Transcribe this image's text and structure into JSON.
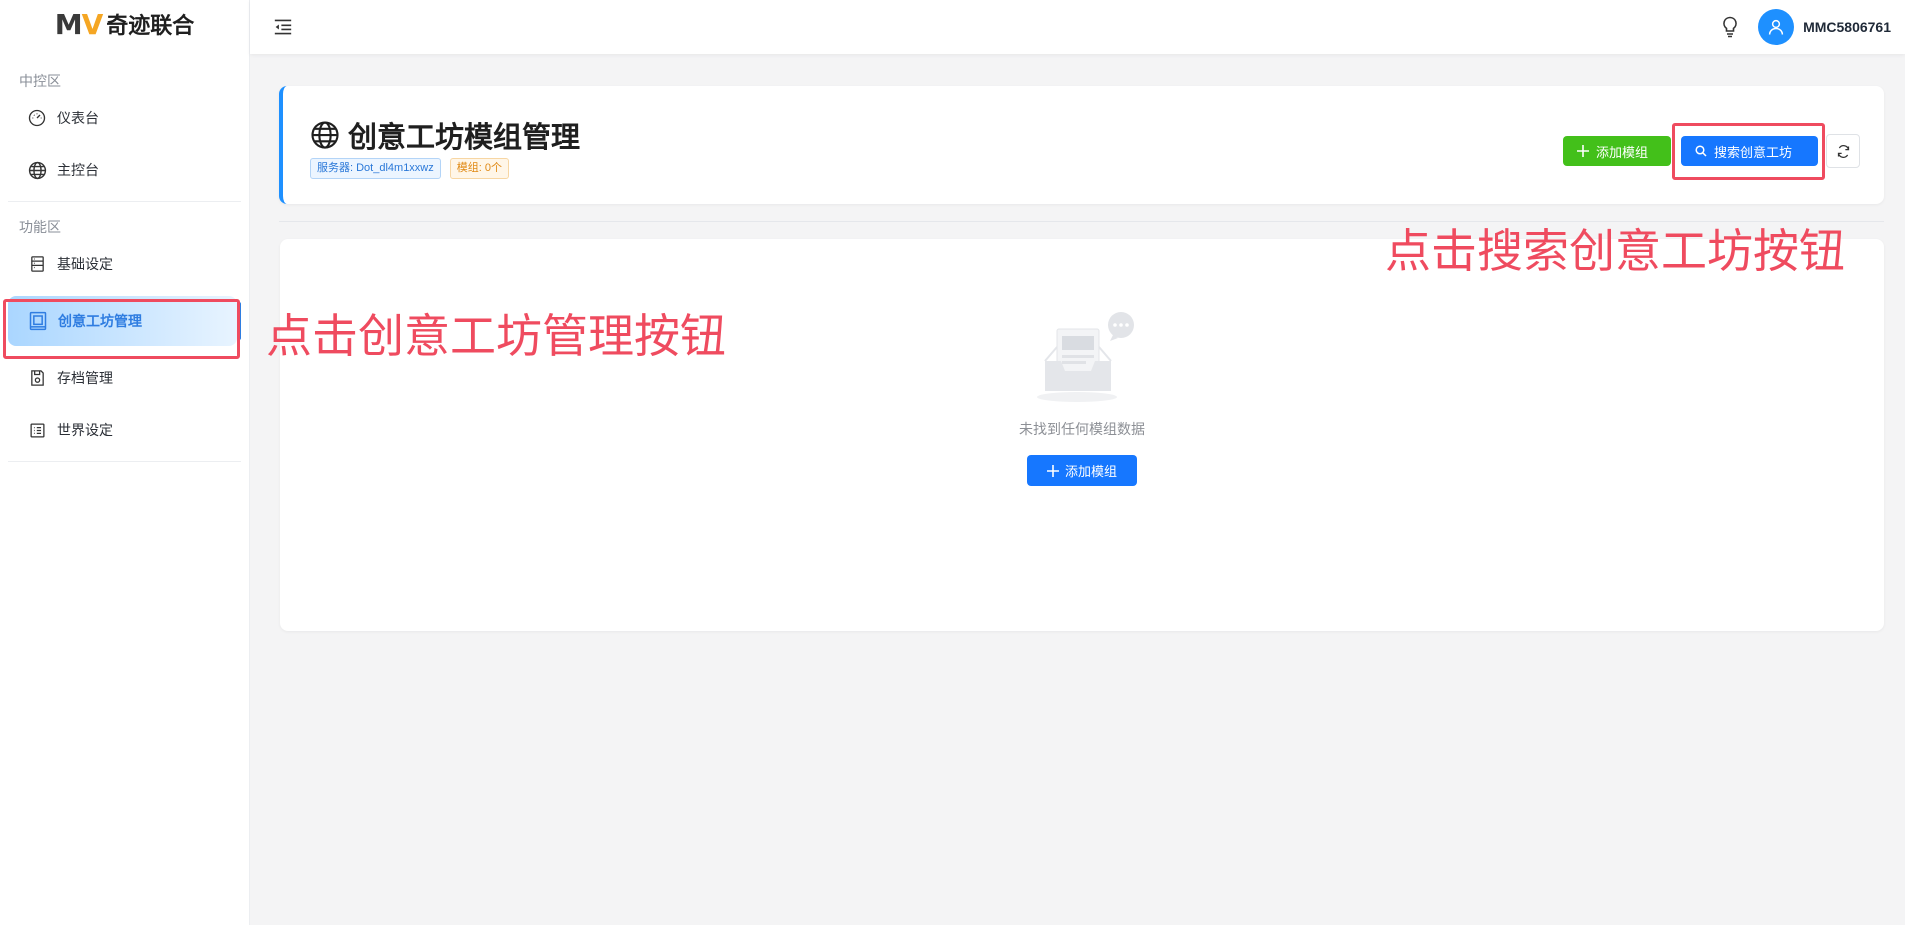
{
  "app": {
    "logo_mark_m": "M",
    "logo_mark_v": "V",
    "logo_text": "奇迹联合"
  },
  "sidebar": {
    "section1_title": "中控区",
    "section1_items": [
      {
        "label": "仪表台",
        "icon": "dashboard-gauge-icon"
      },
      {
        "label": "主控台",
        "icon": "globe-icon"
      }
    ],
    "section2_title": "功能区",
    "section2_items": [
      {
        "label": "基础设定",
        "icon": "server-list-icon"
      },
      {
        "label": "创意工坊管理",
        "icon": "workshop-frame-icon",
        "active": true
      },
      {
        "label": "存档管理",
        "icon": "save-disk-icon"
      },
      {
        "label": "世界设定",
        "icon": "list-icon"
      }
    ]
  },
  "header": {
    "username": "MMC5806761",
    "icons": [
      "menu-fold-icon",
      "lightbulb-icon",
      "user-avatar-icon"
    ]
  },
  "page": {
    "title": "创意工坊模组管理",
    "title_icon": "globe-icon",
    "tag_server": "服务器: Dot_dl4m1xxwz",
    "tag_mods": "模组: 0个",
    "add_mod_button": "添加模组",
    "search_workshop_button": "搜索创意工坊",
    "refresh_icon": "refresh-icon"
  },
  "empty_state": {
    "icon": "empty-inbox-icon",
    "text": "未找到任何模组数据",
    "add_button": "添加模组"
  },
  "annotations": {
    "left": "点击创意工坊管理按钮",
    "right": "点击搜索创意工坊按钮",
    "color": "#ef4b5f"
  },
  "colors": {
    "primary": "#1677ff",
    "success": "#43c01a",
    "accent_border": "#1e90ff"
  }
}
